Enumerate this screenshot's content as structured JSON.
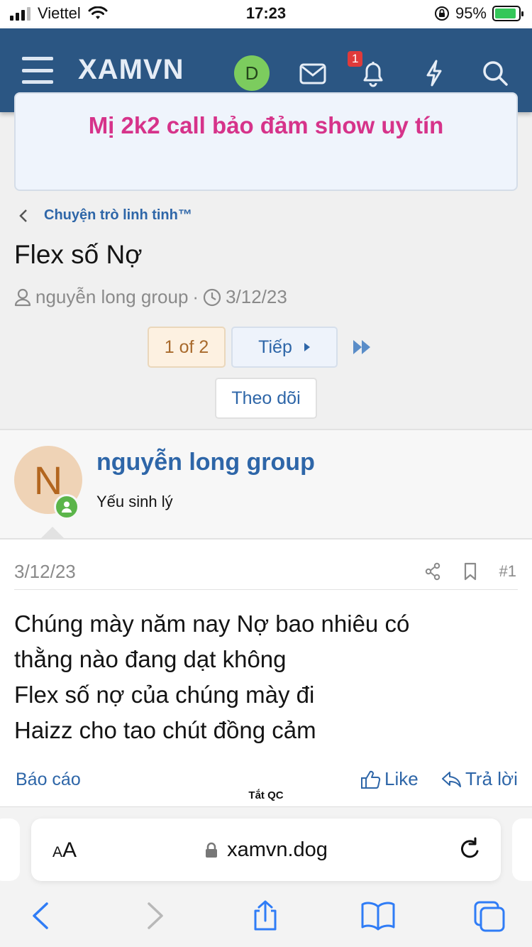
{
  "status_bar": {
    "carrier": "Viettel",
    "time": "17:23",
    "battery": "95%"
  },
  "nav": {
    "logo": "XAMVN",
    "avatar_letter": "D",
    "notification_count": "1",
    "icons": [
      "menu-icon",
      "mail-icon",
      "bell-icon",
      "bolt-icon",
      "search-icon"
    ]
  },
  "banner": {
    "text": "Mị 2k2 call bảo đảm show uy tín"
  },
  "breadcrumb": {
    "label": "Chuyện trò linh tinh™"
  },
  "thread": {
    "title": "Flex số Nợ",
    "author": "nguyễn long group",
    "date": "3/12/23"
  },
  "pagination": {
    "current": "1 of 2",
    "next_label": "Tiếp"
  },
  "follow_label": "Theo dõi",
  "post": {
    "avatar_letter": "N",
    "username": "nguyễn long group",
    "user_title": "Yếu sinh lý",
    "date": "3/12/23",
    "number": "#1",
    "body_lines": [
      "Chúng mày năm nay Nợ bao nhiêu có",
      "thằng nào đang dạt không",
      "Flex số nợ của chúng mày đi",
      "Haizz cho tao chút đồng cảm"
    ],
    "report_label": "Báo cáo",
    "like_label": "Like",
    "reply_label": "Trả lời"
  },
  "ad_toggle": "Tắt QC",
  "browser": {
    "aa_label": "AA",
    "url": "xamvn.dog"
  },
  "colors": {
    "nav_bg": "#2b5683",
    "link": "#2e66a8",
    "banner_text": "#d6338a",
    "online": "#5bb54a"
  }
}
